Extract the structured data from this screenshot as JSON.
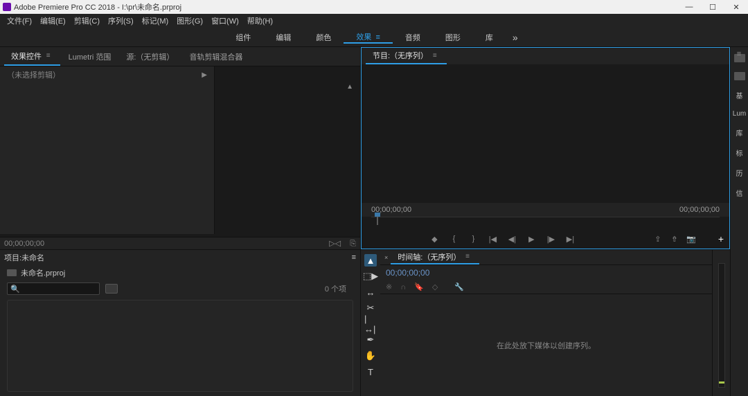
{
  "titlebar": {
    "app": "Adobe Premiere Pro CC 2018 - I:\\pr\\未命名.prproj"
  },
  "menu": [
    "文件(F)",
    "编辑(E)",
    "剪辑(C)",
    "序列(S)",
    "标记(M)",
    "图形(G)",
    "窗口(W)",
    "帮助(H)"
  ],
  "workspaces": {
    "items": [
      "组件",
      "编辑",
      "颜色",
      "效果",
      "音频",
      "图形",
      "库"
    ],
    "activeIndex": 3
  },
  "topLeft": {
    "tabs": [
      "效果控件",
      "Lumetri 范围",
      "源:（无剪辑）",
      "音轨剪辑混合器"
    ],
    "activeIndex": 0,
    "noSelection": "（未选择剪辑）",
    "footerTime": "00;00;00;00"
  },
  "project": {
    "title": "项目:未命名",
    "file": "未命名.prproj",
    "count": "0 个项"
  },
  "program": {
    "tab": "节目:（无序列）",
    "tcLeft": "00;00;00;00",
    "tcRight": "00;00;00;00"
  },
  "timeline": {
    "tab": "时间轴:（无序列）",
    "tc": "00;00;00;00",
    "drophint": "在此处放下媒体以创建序列。"
  },
  "rightPanels": [
    "基",
    "Lum",
    "库",
    "标",
    "历",
    "信"
  ]
}
